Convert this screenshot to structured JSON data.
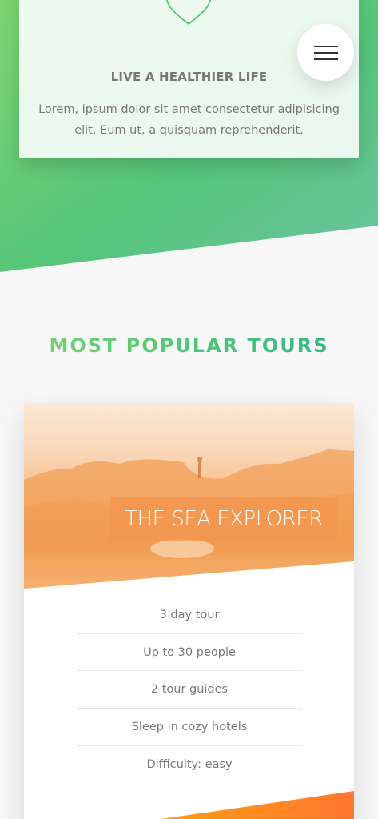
{
  "feature": {
    "icon": "heart-icon",
    "title": "LIVE A HEALTHIER LIFE",
    "text": "Lorem, ipsum dolor sit amet consectetur adipisicing elit. Eum ut, a quisquam reprehenderit."
  },
  "nav": {
    "icon": "menu-icon"
  },
  "section": {
    "title": "MOST POPULAR TOURS"
  },
  "tour": {
    "heading": "THE SEA EXPLORER",
    "details": [
      "3 day tour",
      "Up to 30 people",
      "2 tour guides",
      "Sleep in cozy hotels",
      "Difficulty: easy"
    ]
  },
  "colors": {
    "primary_light": "#7ed56f",
    "primary_dark": "#28b485",
    "secondary_light": "#ffb900",
    "secondary_dark": "#ff7730"
  }
}
